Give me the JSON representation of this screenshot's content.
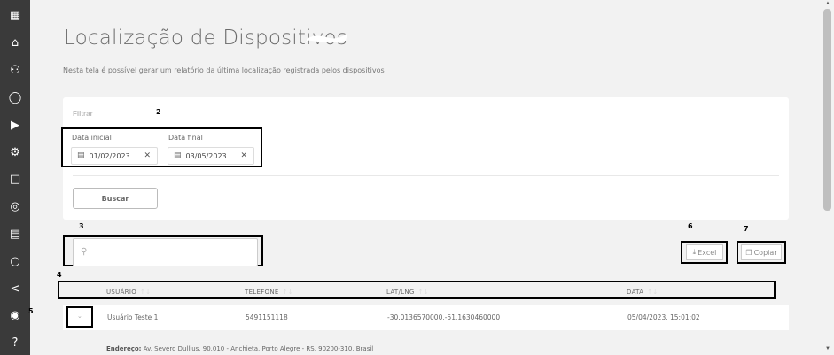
{
  "sidebar": {
    "icons": [
      "apps-grid-icon",
      "home-icon",
      "users-icon",
      "user-icon",
      "play-icon",
      "settings-icon",
      "document-icon",
      "location-target-icon",
      "calendar-icon",
      "chat-icon",
      "share-icon",
      "pin-icon",
      "help-icon"
    ]
  },
  "page": {
    "title": "Localização de Dispositivos",
    "subtitle": "Nesta tela é possível gerar um relatório da última localização registrada pelos dispositivos"
  },
  "filter": {
    "title": "Filtrar",
    "start_label": "Data inicial",
    "start_value": "01/02/2023",
    "end_label": "Data final",
    "end_value": "03/05/2023",
    "search_button": "Buscar"
  },
  "annotations": {
    "n2": "2",
    "n3": "3",
    "n4": "4",
    "n5": "5",
    "n6": "6",
    "n7": "7"
  },
  "toolbar": {
    "excel": "Excel",
    "copy": "Copiar"
  },
  "table": {
    "headers": [
      "USUÁRIO",
      "TELEFONE",
      "LAT/LNG",
      "DATA"
    ],
    "rows": [
      {
        "user": "Usuário Teste 1",
        "phone": "5491151118",
        "latlng": "-30.0136570000,-51.1630460000",
        "date": "05/04/2023, 15:01:02"
      }
    ],
    "address_label": "Endereço:",
    "address_value": "Av. Severo Dullius, 90.010 - Anchieta, Porto Alegre - RS, 90200-310, Brasil"
  }
}
